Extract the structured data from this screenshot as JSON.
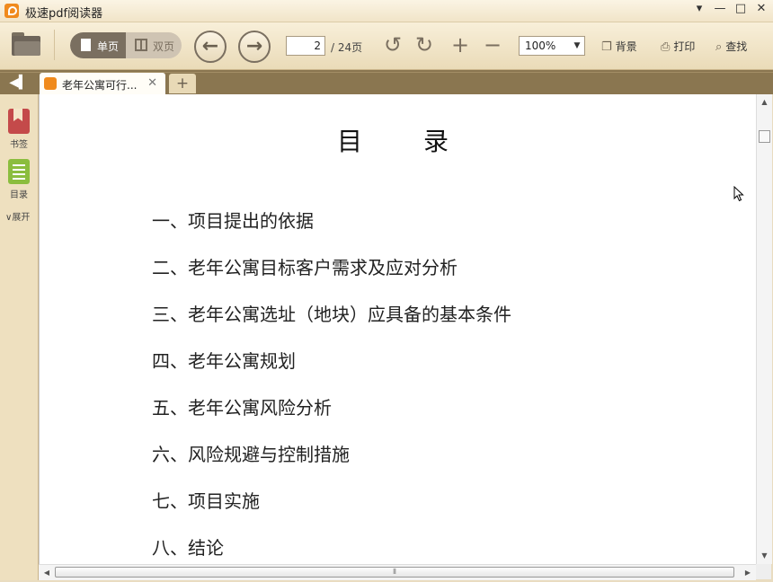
{
  "window": {
    "app_title": "极速pdf阅读器",
    "controls": [
      "▾",
      "—",
      "□",
      "✕"
    ]
  },
  "toolbar": {
    "single_page_label": "单页",
    "double_page_label": "双页",
    "current_page": "2",
    "total_pages": "/ 24页",
    "zoom": "100%",
    "background_label": "背景",
    "print_label": "打印",
    "find_label": "查找"
  },
  "tabs": {
    "active_tab_label": "老年公寓可行...",
    "new_tab_symbol": "+"
  },
  "sidebar": {
    "bookmarks_label": "书签",
    "toc_label": "目录",
    "expand_label": "展开"
  },
  "document": {
    "title": "目　　录",
    "items": [
      "一、项目提出的依据",
      "二、老年公寓目标客户需求及应对分析",
      "三、老年公寓选址（地块）应具备的基本条件",
      "四、老年公寓规划",
      "五、老年公寓风险分析",
      "六、风险规避与控制措施",
      "七、项目实施",
      "八、结论"
    ]
  },
  "colors": {
    "accent": "#f08a1c",
    "toolbar_bg": "#eadbb8",
    "tabbar_bg": "#8a7650",
    "bookmark_icon": "#c44a4a",
    "toc_icon": "#8bbd3e"
  },
  "icons": {
    "open": "folder-icon",
    "prev": "arrow-left-icon",
    "next": "arrow-right-icon",
    "rotate_left": "rotate-ccw-icon",
    "rotate_right": "rotate-cw-icon",
    "zoom_in": "plus-icon",
    "zoom_out": "minus-icon"
  }
}
